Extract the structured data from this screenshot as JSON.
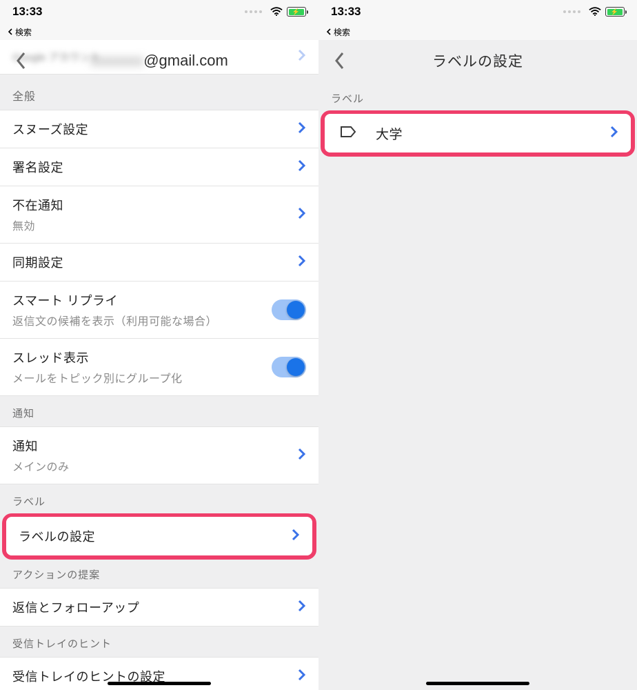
{
  "status": {
    "time": "13:33"
  },
  "breadcrumb": {
    "label": "検索"
  },
  "left": {
    "email_blur": "xxxxxxx",
    "email_domain": "@gmail.com",
    "sections": {
      "general": "全般",
      "notifications": "通知",
      "labels": "ラベル",
      "actions": "アクションの提案",
      "inbox_tips": "受信トレイのヒント"
    },
    "rows": {
      "snooze": "スヌーズ設定",
      "signature": "署名設定",
      "vacation": "不在通知",
      "vacation_sub": "無効",
      "sync": "同期設定",
      "smart_reply": "スマート リプライ",
      "smart_reply_sub": "返信文の候補を表示（利用可能な場合）",
      "thread": "スレッド表示",
      "thread_sub": "メールをトピック別にグループ化",
      "notify": "通知",
      "notify_sub": "メインのみ",
      "label_settings": "ラベルの設定",
      "reply_follow": "返信とフォローアップ",
      "inbox_tips_set": "受信トレイのヒントの設定"
    }
  },
  "right": {
    "title": "ラベルの設定",
    "section": "ラベル",
    "item": "大学"
  }
}
